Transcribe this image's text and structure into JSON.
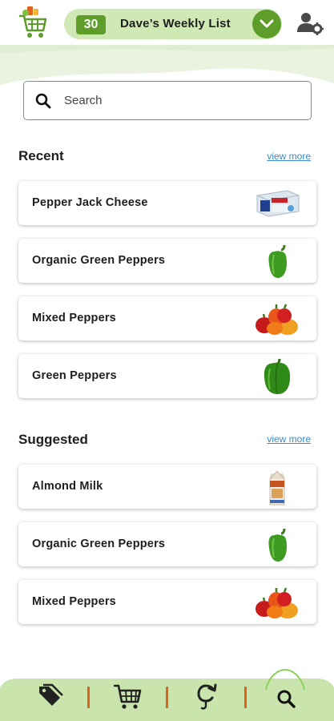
{
  "header": {
    "item_count": "30",
    "list_name": "Dave’s Weekly List",
    "icons": {
      "logo": "grocery-cart-logo",
      "dropdown": "chevron-down-icon",
      "account": "user-settings-icon"
    }
  },
  "search": {
    "placeholder": "Search",
    "value": ""
  },
  "recent": {
    "title": "Recent",
    "view_more": "view more",
    "items": [
      {
        "label": "Pepper Jack Cheese",
        "image": "cheese-package"
      },
      {
        "label": "Organic Green Peppers",
        "image": "green-pepper"
      },
      {
        "label": "Mixed Peppers",
        "image": "mixed-peppers"
      },
      {
        "label": "Green Peppers",
        "image": "green-pepper-large"
      }
    ]
  },
  "suggested": {
    "title": "Suggested",
    "view_more": "view more",
    "items": [
      {
        "label": "Almond Milk",
        "image": "almond-milk-carton"
      },
      {
        "label": "Organic Green Peppers",
        "image": "green-pepper"
      },
      {
        "label": "Mixed Peppers",
        "image": "mixed-peppers"
      }
    ]
  },
  "bottom_nav": {
    "items": [
      {
        "icon": "tags-icon"
      },
      {
        "icon": "cart-icon"
      },
      {
        "icon": "reorder-icon"
      },
      {
        "icon": "search-icon",
        "active": true
      }
    ]
  },
  "colors": {
    "brand_green": "#5f9d2b",
    "light_green": "#cfe8b4",
    "nav_green": "#c9e5ad",
    "accent_orange": "#e2621c",
    "link_blue": "#3a8bc6"
  }
}
